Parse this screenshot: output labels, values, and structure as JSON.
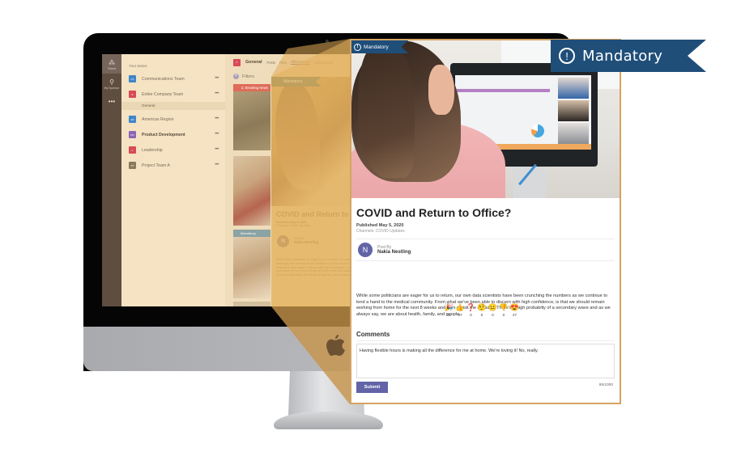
{
  "banner": {
    "icon": "exclamation-circle-icon",
    "label": "Mandatory",
    "color": "#1f4e79"
  },
  "teams_app": {
    "rail": [
      {
        "icon": "teams-icon",
        "label": "Teams"
      },
      {
        "icon": "sponsor-icon",
        "label": "My Sponsor"
      },
      {
        "icon": "more-icon",
        "label": "•••"
      }
    ],
    "heading": "Your teams",
    "teams": [
      {
        "name": "Communications Team",
        "tile_color": "#3f86c8",
        "initials": "CT",
        "bold": false
      },
      {
        "name": "Entire Company Team",
        "tile_color": "#d84a58",
        "initials": "E",
        "bold": false,
        "channel": "General"
      },
      {
        "name": "Americas Region",
        "tile_color": "#3f86c8",
        "initials": "AR",
        "bold": false
      },
      {
        "name": "Product Development",
        "tile_color": "#8e63b8",
        "initials": "PD",
        "bold": true
      },
      {
        "name": "Leadership",
        "tile_color": "#d84a58",
        "initials": "L",
        "bold": false
      },
      {
        "name": "Project Team A",
        "tile_color": "#8a7a5a",
        "initials": "PT",
        "bold": false
      }
    ],
    "more_label": "•••",
    "channel_header": {
      "tile": "F",
      "title": "General",
      "tabs": [
        "Posts",
        "Files",
        "Official News",
        "Social News"
      ],
      "active_tab": "Official News"
    },
    "filters_label": "Filters",
    "breaking_label": "Breaking News",
    "mini_mandatory_label": "Mandatory"
  },
  "ghost_card": {
    "mandatory_label": "Mandatory",
    "title": "COVID and Return to",
    "published": "Published May 5, 2020",
    "channels": "Channels: COVID Updates",
    "avatar": "N",
    "post_by": "Post By",
    "author": "Nakia Nestling",
    "body": "While some politicians are eager for us to return, our own data scientists have been crunching the numbers as we continue to lend a hand to the medical community. From what we've been able to discern with high confidence, is that we should remain working from home for the next 8 weeks and then revisit the decision. There's a high probabiliy of a secondary wave and as we always say, we are about health, family, and people."
  },
  "article": {
    "mandatory_label": "Mandatory",
    "title": "COVID and Return to Office?",
    "published": "Published May 5, 2020",
    "channels": "Channels: COVID Updates",
    "author": {
      "avatar": "N",
      "label": "Post By",
      "name": "Nakia Nestling",
      "color": "#6264a7"
    },
    "body": "While some politicians are eager for us to return, our own data scientists have been crunching the numbers as we continue to lend a hand to the medical community. From what we've been able to discern with high confidence, is that we should remain working from home for the next 8 weeks and then revisit the decision. There's a high probabiliy of a secondary wave and as we always say, we are about health, family, and people.",
    "reactions": [
      {
        "icon": "party-popper-icon",
        "glyph": "🎉",
        "count": "32"
      },
      {
        "icon": "thumbs-up-icon",
        "glyph": "👍",
        "count": "97"
      },
      {
        "icon": "question-icon",
        "glyph": "❓",
        "count": "0"
      },
      {
        "icon": "confused-face-icon",
        "glyph": "🤨",
        "count": "0"
      },
      {
        "icon": "neutral-face-icon",
        "glyph": "😐",
        "count": "0"
      },
      {
        "icon": "thumbs-down-icon",
        "glyph": "👎",
        "count": "0"
      },
      {
        "icon": "heart-eyes-icon",
        "glyph": "😍",
        "count": "27"
      }
    ],
    "comments": {
      "heading": "Comments",
      "value": "Having flexible hours is making all the difference for me at home. We're loving it! No, really.",
      "char_count": "95/1000",
      "submit_label": "Submit"
    }
  }
}
